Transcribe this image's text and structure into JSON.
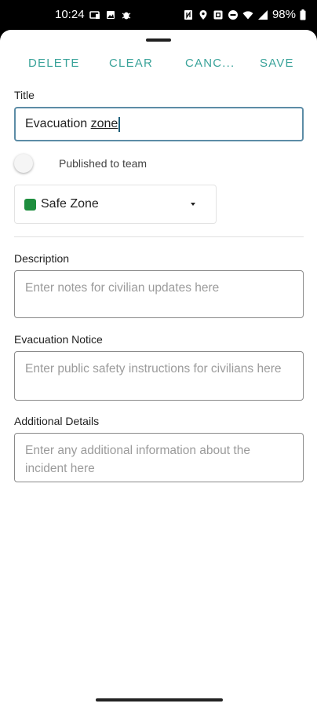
{
  "status_bar": {
    "time": "10:24",
    "battery": "98%",
    "left_icons": [
      "cast-icon",
      "image-icon",
      "bug-icon"
    ],
    "right_icons": [
      "nfc-icon",
      "location-icon",
      "screenshot-icon",
      "minus-circle-icon",
      "wifi-icon",
      "signal-icon",
      "battery-icon"
    ]
  },
  "actions": {
    "delete": "DELETE",
    "clear": "CLEAR",
    "cancel": "CANC...",
    "save": "SAVE"
  },
  "title_field": {
    "label": "Title",
    "value_part1": "Evacuation ",
    "value_part2": "zone"
  },
  "publish_toggle": {
    "label": "Published to team",
    "on": false
  },
  "zone_select": {
    "selected": "Safe Zone",
    "color": "#1e8e3e"
  },
  "description": {
    "label": "Description",
    "placeholder": "Enter notes for civilian updates here"
  },
  "evacuation_notice": {
    "label": "Evacuation Notice",
    "placeholder": "Enter public safety instructions for civilians here"
  },
  "additional_details": {
    "label": "Additional Details",
    "placeholder": "Enter any additional information about the incident here"
  },
  "colors": {
    "accent": "#3aa39a",
    "focus_border": "#5c8ca6"
  }
}
